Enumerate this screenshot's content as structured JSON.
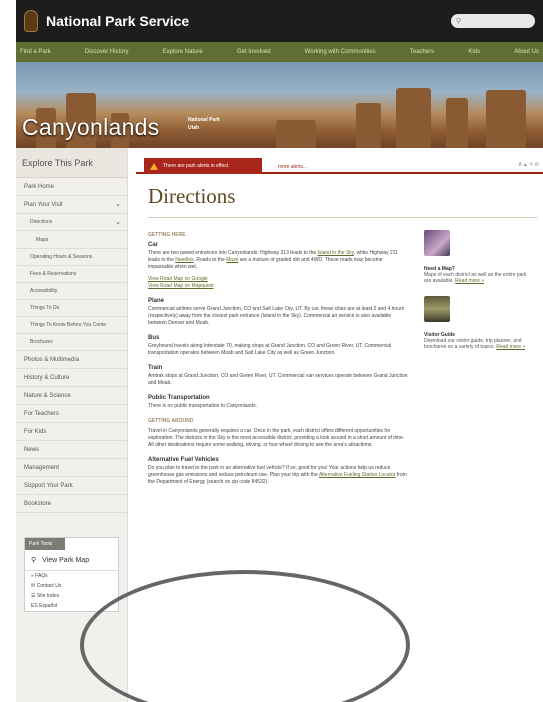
{
  "header": {
    "brand": "National Park Service",
    "search_placeholder": "Search"
  },
  "nav": [
    "Find a Park",
    "Discover History",
    "Explore Nature",
    "Get Involved",
    "Working with Communities",
    "Teachers",
    "Kids",
    "About Us"
  ],
  "hero": {
    "park_name": "Canyonlands",
    "designation": "National Park",
    "state": "Utah"
  },
  "sidebar": {
    "explore": "Explore This Park",
    "items": [
      {
        "label": "Park Home",
        "level": 1
      },
      {
        "label": "Plan Your Visit",
        "level": 1,
        "arrow": "⌄"
      },
      {
        "label": "Directions",
        "level": 2,
        "arrow": "⌄"
      },
      {
        "label": "Maps",
        "level": 3
      },
      {
        "label": "Operating Hours & Seasons",
        "level": 2
      },
      {
        "label": "Fees & Reservations",
        "level": 2
      },
      {
        "label": "Accessibility",
        "level": 2
      },
      {
        "label": "Things To Do",
        "level": 2
      },
      {
        "label": "Things To Know Before You Come",
        "level": 2
      },
      {
        "label": "Brochures",
        "level": 2
      },
      {
        "label": "Photos & Multimedia",
        "level": 1
      },
      {
        "label": "History & Culture",
        "level": 1
      },
      {
        "label": "Nature & Science",
        "level": 1
      },
      {
        "label": "For Teachers",
        "level": 1
      },
      {
        "label": "For Kids",
        "level": 1
      },
      {
        "label": "News",
        "level": 1
      },
      {
        "label": "Management",
        "level": 1
      },
      {
        "label": "Support Your Park",
        "level": 1
      },
      {
        "label": "Bookstore",
        "level": 1
      }
    ],
    "tools": {
      "header": "Park Tools",
      "map": "View Park Map",
      "links": [
        "FAQs",
        "Contact Us",
        "Site Index",
        "Español"
      ]
    }
  },
  "alert": {
    "tab": "There are park alerts in effect",
    "more": "more alerts..."
  },
  "utility": "A ▲ ✎ ✉",
  "page_title": "Directions",
  "content": {
    "getting_here": "GETTING HERE",
    "car_h": "Car",
    "car_p1": "There are two paved entrances into Canyonlands: Highway 313 leads to the",
    "car_link1": "Island in the Sky",
    "car_p2": ", while Highway 211 leads to the",
    "car_link2": "Needles",
    "car_p3": ". Roads to the",
    "car_link3": "Maze",
    "car_p4": "are a mixture of graded dirt and 4WD. These roads may become impassable when wet.",
    "map_link1": "View Road Map on Google",
    "map_link2": "View Road Map on Mapquest",
    "plane_h": "Plane",
    "plane_p": "Commercial airlines serve Grand Junction, CO and Salt Lake City, UT. By car, these cities are at least 2 and 4 hours (respectively) away from the closest park entrance (Island in the Sky). Commercial air service is also available between Denver and Moab.",
    "bus_h": "Bus",
    "bus_p": "Greyhound travels along Interstate 70, making stops at Grand Junction, CO and Green River, UT. Commercial transportation operates between Moab and Salt Lake City as well as Green Junction.",
    "train_h": "Train",
    "train_p": "Amtrak stops at Grand Junction, CO and Green River, UT. Commercial van services operate between Grand Junction and Moab.",
    "public_h": "Public Transportation",
    "public_p": "There is no public transportation to Canyonlands.",
    "getting_around": "GETTING AROUND",
    "around_p": "Travel in Canyonlands generally requires a car. Once in the park, each district offers different opportunities for exploration. The districts in the Sky is the most accessible district, providing a look around in a short amount of time. All other destinations require some walking, driving, or four-wheel driving to see the area's attractions.",
    "alt_h": "Alternative Fuel Vehicles",
    "alt_p1": "Do you plan to travel to the park in an alternative fuel vehicle? If so, good for you! Your actions help us reduce greenhouse gas emissions and reduce petroleum use. Plan your trip with the",
    "alt_link": "Alternative Fueling Station Locator",
    "alt_p2": "from the Department of Energy (search on zip code 84532)."
  },
  "right": {
    "card1_title": "Need a Map?",
    "card1_text": "Maps of each district as well as the entire park are available.",
    "card1_link": "Read more »",
    "card2_title": "Visitor Guide",
    "card2_text": "Download our visitor guide, trip planner, and brochures on a variety of topics.",
    "card2_link": "Read more »"
  }
}
